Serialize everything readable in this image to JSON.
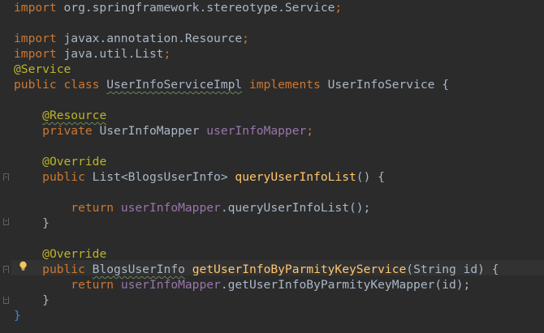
{
  "editor": {
    "language": "Java",
    "colors": {
      "background": "#2b2b2b",
      "keyword": "#cc7832",
      "annotation": "#bbb529",
      "field": "#9876aa",
      "method": "#ffc66d",
      "text": "#a9b7c6",
      "caret_line": "#323232"
    },
    "lines": {
      "l1": {
        "kw": "import",
        "text": " org.springframework.stereotype.",
        "cls": "Service",
        "end": ";"
      },
      "l3": {
        "kw": "import",
        "text": " javax.annotation.",
        "cls": "Resource",
        "end": ";"
      },
      "l4": {
        "kw": "import",
        "text": " java.util.",
        "cls": "List",
        "end": ";"
      },
      "l5": {
        "anno": "@Service"
      },
      "l6": {
        "kw1": "public class",
        "name": "UserInfoServiceImpl",
        "kw2": "implements",
        "iface": "UserInfoService",
        "brace": "{"
      },
      "l8": {
        "anno": "@Resource"
      },
      "l9": {
        "kw": "private",
        "type": "UserInfoMapper",
        "field": "userInfoMapper",
        "end": ";"
      },
      "l11": {
        "anno": "@Override"
      },
      "l12": {
        "kw": "public",
        "type": "List<BlogsUserInfo>",
        "method": "queryUserInfoList",
        "params": "() {"
      },
      "l14": {
        "kw": "return",
        "field": "userInfoMapper",
        "call": ".queryUserInfoList();"
      },
      "l15": {
        "brace": "}"
      },
      "l17": {
        "anno": "@Override"
      },
      "l18": {
        "kw": "public",
        "type": "BlogsUserInfo",
        "method": "getUserInfoByParmityKeyService",
        "params": "(String id) {"
      },
      "l19": {
        "kw": "return",
        "field": "userInfoMapper",
        "call": ".getUserInfoByParmityKeyMapper(id);"
      },
      "l20": {
        "brace": "}"
      },
      "l21": {
        "brace": "}"
      }
    },
    "gutter": {
      "fold_icon": "fold-marker-icon",
      "intention_icon": "lightbulb-icon"
    }
  }
}
